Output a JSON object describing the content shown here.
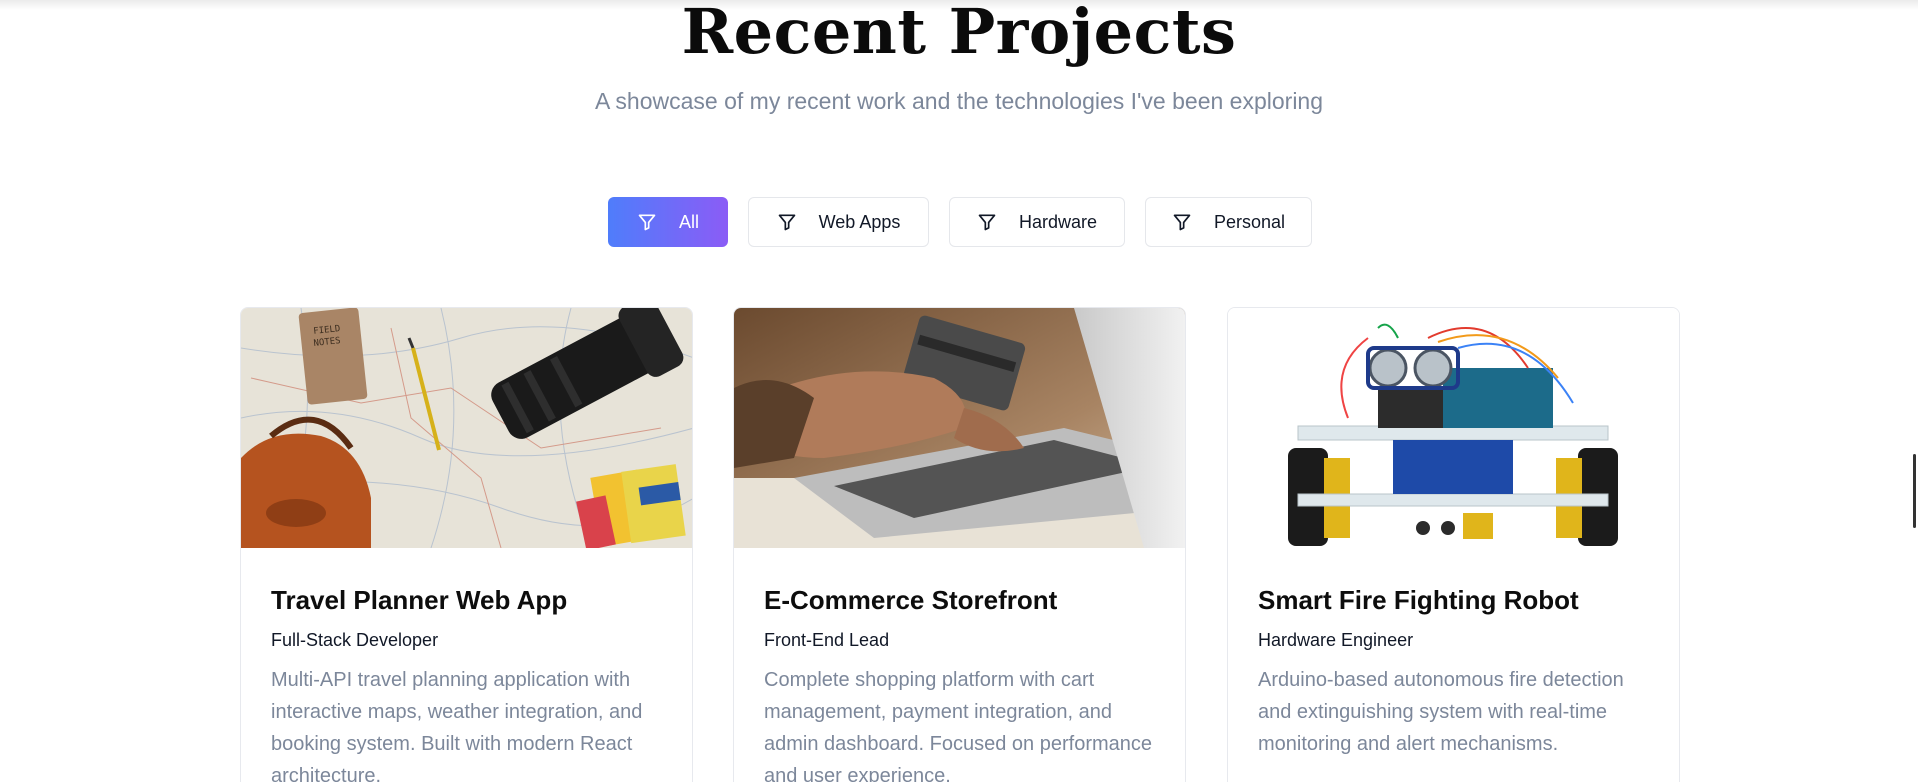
{
  "header": {
    "title": "Recent Projects",
    "subtitle": "A showcase of my recent work and the technologies I've been exploring"
  },
  "filters": [
    {
      "label": "All",
      "icon": "filter-icon",
      "active": true
    },
    {
      "label": "Web Apps",
      "icon": "filter-icon",
      "active": false
    },
    {
      "label": "Hardware",
      "icon": "filter-icon",
      "active": false
    },
    {
      "label": "Personal",
      "icon": "filter-icon",
      "active": false
    }
  ],
  "projects": [
    {
      "title": "Travel Planner Web App",
      "role": "Full-Stack Developer",
      "description": "Multi-API travel planning application with interactive maps, weather integration, and booking system. Built with modern React architecture."
    },
    {
      "title": "E-Commerce Storefront",
      "role": "Front-End Lead",
      "description": "Complete shopping platform with cart management, payment integration, and admin dashboard. Focused on performance and user experience."
    },
    {
      "title": "Smart Fire Fighting Robot",
      "role": "Hardware Engineer",
      "description": "Arduino-based autonomous fire detection and extinguishing system with real-time monitoring and alert mechanisms."
    }
  ],
  "colors": {
    "accent_start": "#4f7dfb",
    "accent_end": "#8b5cf6",
    "muted_text": "#7c879a",
    "border": "#e5e7eb"
  }
}
